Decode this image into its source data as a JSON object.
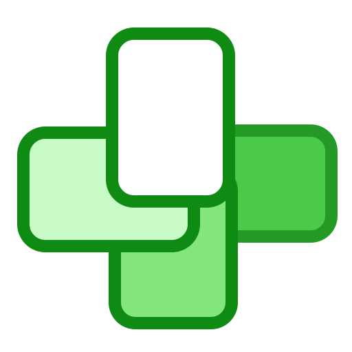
{
  "icon": {
    "name": "overlapping-rounded-rectangles-plus-icon",
    "colors": {
      "background": "#ffffff",
      "stroke_dark": "#0f8a13",
      "stroke_mid": "#249a25",
      "fill_right": "#4cc84b",
      "fill_bottom": "#82e67c",
      "fill_left": "#c8fac8",
      "fill_top": "#ffffff"
    }
  }
}
